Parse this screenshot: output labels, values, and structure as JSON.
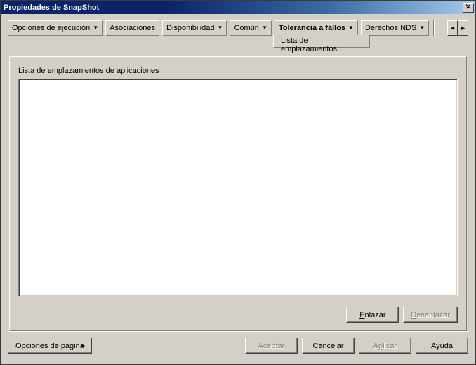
{
  "window": {
    "title": "Propiedades de SnapShot",
    "close_glyph": "✕"
  },
  "tabs": {
    "items": [
      {
        "label": "Opciones de ejecución",
        "dropdown": true,
        "active": false
      },
      {
        "label": "Asociaciones",
        "dropdown": false,
        "active": false
      },
      {
        "label": "Disponibilidad",
        "dropdown": true,
        "active": false
      },
      {
        "label": "Común",
        "dropdown": true,
        "active": false
      },
      {
        "label": "Tolerancia a fallos",
        "dropdown": true,
        "active": true
      },
      {
        "label": "Derechos NDS",
        "dropdown": true,
        "active": false
      }
    ],
    "overflow_left": "◄",
    "overflow_right": "►",
    "subtab": "Lista de emplazamientos"
  },
  "panel": {
    "section_label": "Lista de emplazamientos de aplicaciones",
    "link_button": "Enlazar",
    "unlink_button": "Desenlazar"
  },
  "footer": {
    "page_options": "Opciones de página",
    "accept": "Aceptar",
    "cancel": "Cancelar",
    "apply": "Aplicar",
    "help": "Ayuda"
  }
}
